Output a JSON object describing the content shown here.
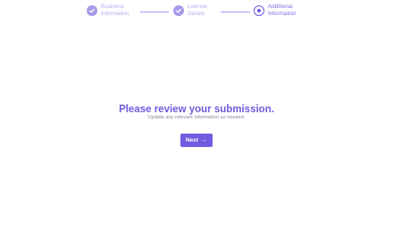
{
  "stepper": {
    "steps": [
      {
        "label": "Business Information",
        "status": "completed",
        "icon": "check-icon"
      },
      {
        "label": "License Details",
        "status": "completed",
        "icon": "check-icon"
      },
      {
        "label": "Additional Information",
        "status": "current",
        "icon": "current-step-icon"
      }
    ]
  },
  "main": {
    "title": "Please review your submission.",
    "subtitle": "Update any relevant information as needed."
  },
  "actions": {
    "next_label": "Next",
    "next_icon": "arrow-right-icon",
    "next_arrow": "→"
  },
  "colors": {
    "accent": "#6f5ce0",
    "accent_light": "#a89ae8",
    "muted_text": "#8a8a96"
  }
}
